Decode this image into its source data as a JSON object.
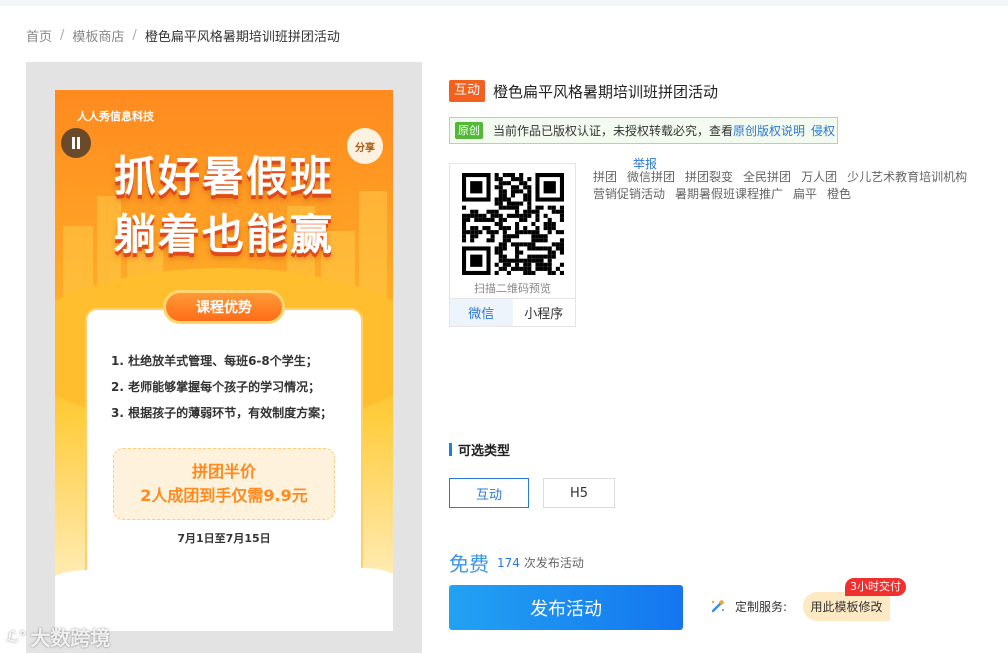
{
  "breadcrumb": {
    "home": "首页",
    "sep": "/",
    "store": "模板商店",
    "current": "橙色扁平风格暑期培训班拼团活动"
  },
  "preview": {
    "company": "人人秀信息科技",
    "share": "分享",
    "headline_1": "抓好暑假班",
    "headline_2": "躺着也能赢",
    "card_tab": "课程优势",
    "points": [
      "1. 杜绝放羊式管理、每班6-8个学生；",
      "2. 老师能够掌握每个孩子的学习情况；",
      "3. 根据孩子的薄弱环节，有效制度方案；"
    ],
    "price_line_1": "拼团半价",
    "price_line_2": "2人成团到手仅需9.9元",
    "date_range": "7月1日至7月15日"
  },
  "watermark": {
    "logo": "ℒ°",
    "text": "大数跨境"
  },
  "info": {
    "tag": "互动",
    "title": "橙色扁平风格暑期培训班拼团活动",
    "copyright": {
      "badge": "原创",
      "text": "当前作品已版权认证，未授权转载必究，查看",
      "link": "原创版权说明",
      "infringe": "侵权"
    },
    "qr": {
      "caption": "扫描二维码预览",
      "tabs": [
        "微信",
        "小程序"
      ]
    },
    "report": "举报",
    "keywords": [
      "拼团",
      "微信拼团",
      "拼团裂变",
      "全民拼团",
      "万人团",
      "少儿艺术教育培训机构",
      "营销促销活动",
      "暑期暑假班课程推广",
      "扁平",
      "橙色"
    ],
    "types_title": "可选类型",
    "types": [
      "互动",
      "H5"
    ],
    "price": "免费",
    "publish_count": "174",
    "publish_suffix": "次发布活动",
    "publish_button": "发布活动",
    "custom_label": "定制服务:",
    "custom_button": "用此模板修改",
    "custom_badge": "3小时交付"
  },
  "colors": {
    "accent": "#2a77d6",
    "tag_orange": "#f4601d",
    "badge_green": "#52b936",
    "badge_red": "#f0302e"
  }
}
